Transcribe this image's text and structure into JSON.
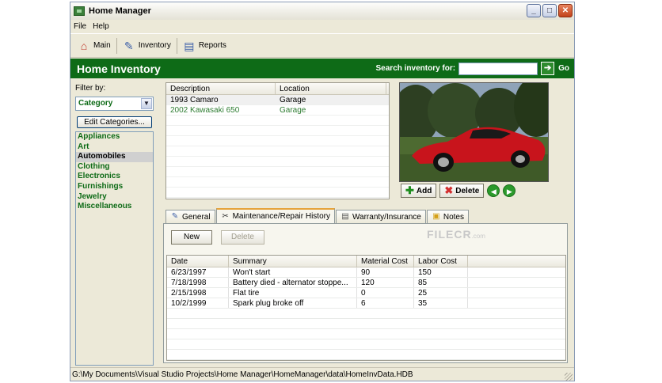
{
  "window": {
    "title": "Home Manager"
  },
  "menu": [
    "File",
    "Help"
  ],
  "toolbar": [
    {
      "label": "Main",
      "icon": "house-icon"
    },
    {
      "label": "Inventory",
      "icon": "clipboard-icon"
    },
    {
      "label": "Reports",
      "icon": "report-icon"
    }
  ],
  "header": {
    "title": "Home Inventory",
    "search_label": "Search inventory for:",
    "search_value": "",
    "go_label": "Go"
  },
  "filter": {
    "label": "Filter by:",
    "selected": "Category",
    "edit_button": "Edit Categories...",
    "categories": [
      "Appliances",
      "Art",
      "Automobiles",
      "Clothing",
      "Electronics",
      "Furnishings",
      "Jewelry",
      "Miscellaneous"
    ],
    "selected_category": "Automobiles"
  },
  "items": {
    "columns": [
      "Description",
      "Location"
    ],
    "rows": [
      {
        "description": "1993 Camaro",
        "location": "Garage"
      },
      {
        "description": "2002 Kawasaki 650",
        "location": "Garage"
      }
    ]
  },
  "photo_actions": {
    "add": "Add",
    "delete": "Delete"
  },
  "tabs": [
    "General",
    "Maintenance/Repair History",
    "Warranty/Insurance",
    "Notes"
  ],
  "active_tab": "Maintenance/Repair History",
  "maintenance": {
    "new_label": "New",
    "delete_label": "Delete",
    "columns": [
      "Date",
      "Summary",
      "Material Cost",
      "Labor Cost"
    ],
    "rows": [
      {
        "date": "6/23/1997",
        "summary": "Won't start",
        "material": "90",
        "labor": "150"
      },
      {
        "date": "7/18/1998",
        "summary": "Battery died - alternator stoppe...",
        "material": "120",
        "labor": "85"
      },
      {
        "date": "2/15/1998",
        "summary": "Flat tire",
        "material": "0",
        "labor": "25"
      },
      {
        "date": "10/2/1999",
        "summary": "Spark plug broke off",
        "material": "6",
        "labor": "35"
      }
    ]
  },
  "watermark": {
    "brand": "FILECR",
    "suffix": ".com"
  },
  "status": {
    "path": "G:\\My Documents\\Visual Studio Projects\\Home Manager\\HomeManager\\data\\HomeInvData.HDB"
  },
  "colors": {
    "header_green": "#0e6b17",
    "category_green": "#0e6b17",
    "tab_highlight": "#e6a33a"
  }
}
